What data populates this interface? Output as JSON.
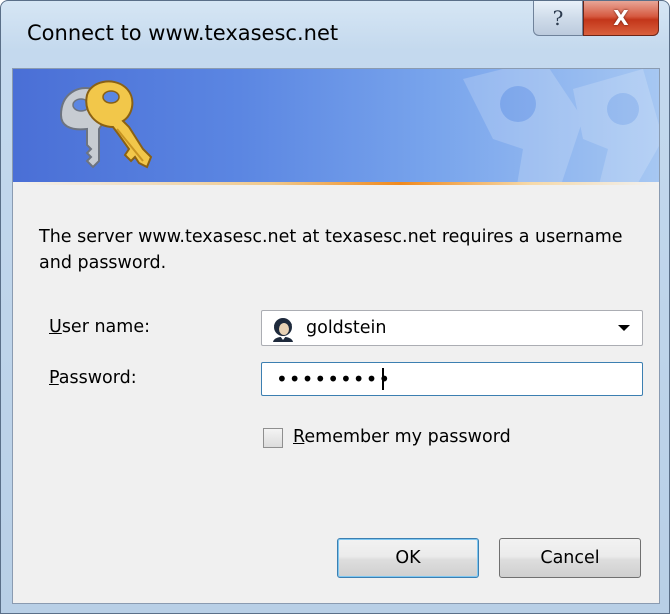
{
  "window": {
    "title": "Connect to www.texasesc.net",
    "help_glyph": "?",
    "close_glyph": "X"
  },
  "banner": {
    "icon": "keys-icon",
    "accent_colors": {
      "gradient_start": "#4a6fd6",
      "gradient_end": "#a6c7f2",
      "underline": "#f08a1e"
    }
  },
  "message": "The server www.texasesc.net at texasesc.net requires a username and password.",
  "form": {
    "username": {
      "label_mnemonic": "U",
      "label_rest": "ser name:",
      "value": "goldstein",
      "icon": "user-icon"
    },
    "password": {
      "label_mnemonic": "P",
      "label_rest": "assword:",
      "masked_value": "•••••••••"
    },
    "remember": {
      "label_mnemonic": "R",
      "label_rest": "emember my password",
      "checked": false
    }
  },
  "buttons": {
    "ok": "OK",
    "cancel": "Cancel"
  }
}
